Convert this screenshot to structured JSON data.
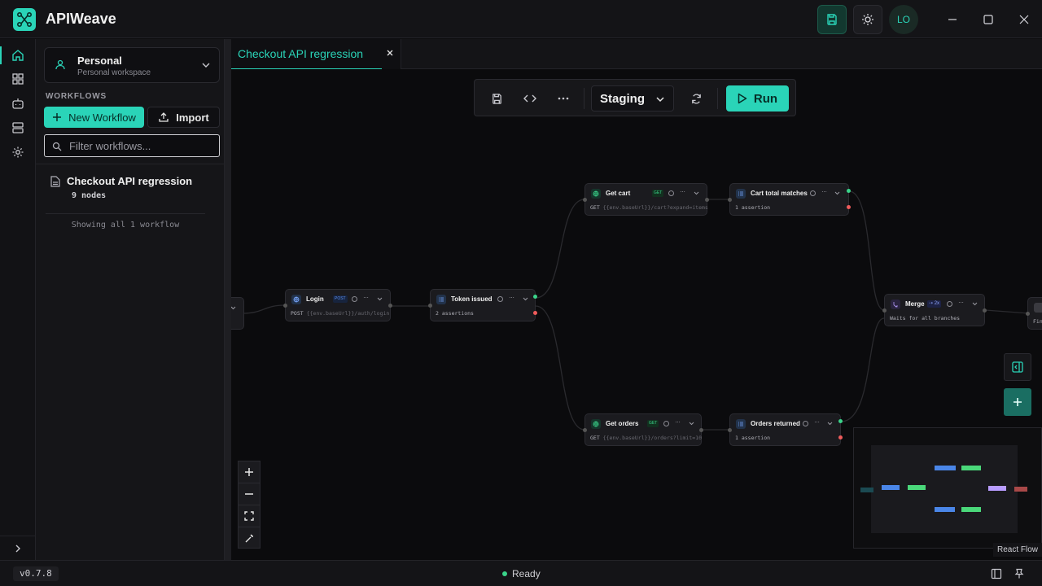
{
  "app": {
    "title": "APIWeave",
    "user_initials": "LO"
  },
  "colors": {
    "accent": "#2ad4b8",
    "success": "#3ad48a",
    "error": "#ef5b5b",
    "get": "#3ad48a",
    "post": "#5a8ef0"
  },
  "sidebar": {
    "workspace": {
      "name": "Personal",
      "subtitle": "Personal workspace"
    },
    "section_label": "WORKFLOWS",
    "new_workflow_label": "New Workflow",
    "import_label": "Import",
    "filter_placeholder": "Filter workflows...",
    "workflows": [
      {
        "name": "Checkout API regression",
        "nodes": "9 nodes"
      }
    ],
    "count_text": "Showing all 1 workflow"
  },
  "tabs": [
    {
      "label": "Checkout API regression",
      "active": true
    }
  ],
  "toolbar": {
    "environment": "Staging",
    "run_label": "Run"
  },
  "nodes": {
    "login": {
      "name": "Login",
      "method": "POST",
      "path_prefix": "POST",
      "path_dim": "{{env.baseUrl}}/auth/login"
    },
    "token": {
      "name": "Token issued",
      "sub": "2 assertions"
    },
    "get_cart": {
      "name": "Get cart",
      "method": "GET",
      "path_prefix": "GET",
      "path_dim": "{{env.baseUrl}}/cart?expand=items"
    },
    "cart_total": {
      "name": "Cart total matches",
      "sub": "1 assertion"
    },
    "get_orders": {
      "name": "Get orders",
      "method": "GET",
      "path_prefix": "GET",
      "path_dim": "{{env.baseUrl}}/orders?limit=10"
    },
    "orders_returned": {
      "name": "Orders returned",
      "sub": "1 assertion"
    },
    "merge": {
      "name": "Merge",
      "badge": "2x",
      "sub": "Waits for all branches"
    },
    "final": {
      "sub": "Fin"
    }
  },
  "minimap": {
    "attribution": "React Flow"
  },
  "status": {
    "version": "v0.7.8",
    "text": "Ready"
  }
}
